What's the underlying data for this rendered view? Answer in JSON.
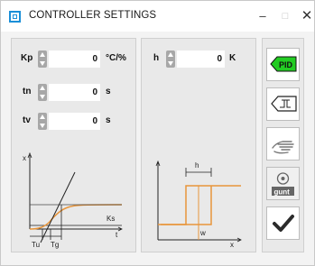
{
  "window": {
    "title": "CONTROLLER SETTINGS"
  },
  "titlebar": {
    "minimize": "–",
    "maximize": "□",
    "close": "✕"
  },
  "pid_panel": {
    "params": [
      {
        "label": "Kp",
        "value": "0",
        "unit": "°C/%"
      },
      {
        "label": "tn",
        "value": "0",
        "unit": "s"
      },
      {
        "label": "tv",
        "value": "0",
        "unit": "s"
      }
    ],
    "graph": {
      "y_label": "x",
      "x_label": "t",
      "ks_label": "Ks",
      "tu_label": "Tu",
      "tg_label": "Tg"
    }
  },
  "hyst_panel": {
    "param": {
      "label": "h",
      "value": "0",
      "unit": "K"
    },
    "graph": {
      "h_label": "h",
      "w_label": "w",
      "x_label": "x"
    }
  },
  "sidebar": {
    "pid_label": "PID",
    "gunt_label": "gunt"
  },
  "colors": {
    "accent": "#1a8fd8",
    "pid_green": "#22cc22",
    "curve_orange": "#e8953a"
  }
}
